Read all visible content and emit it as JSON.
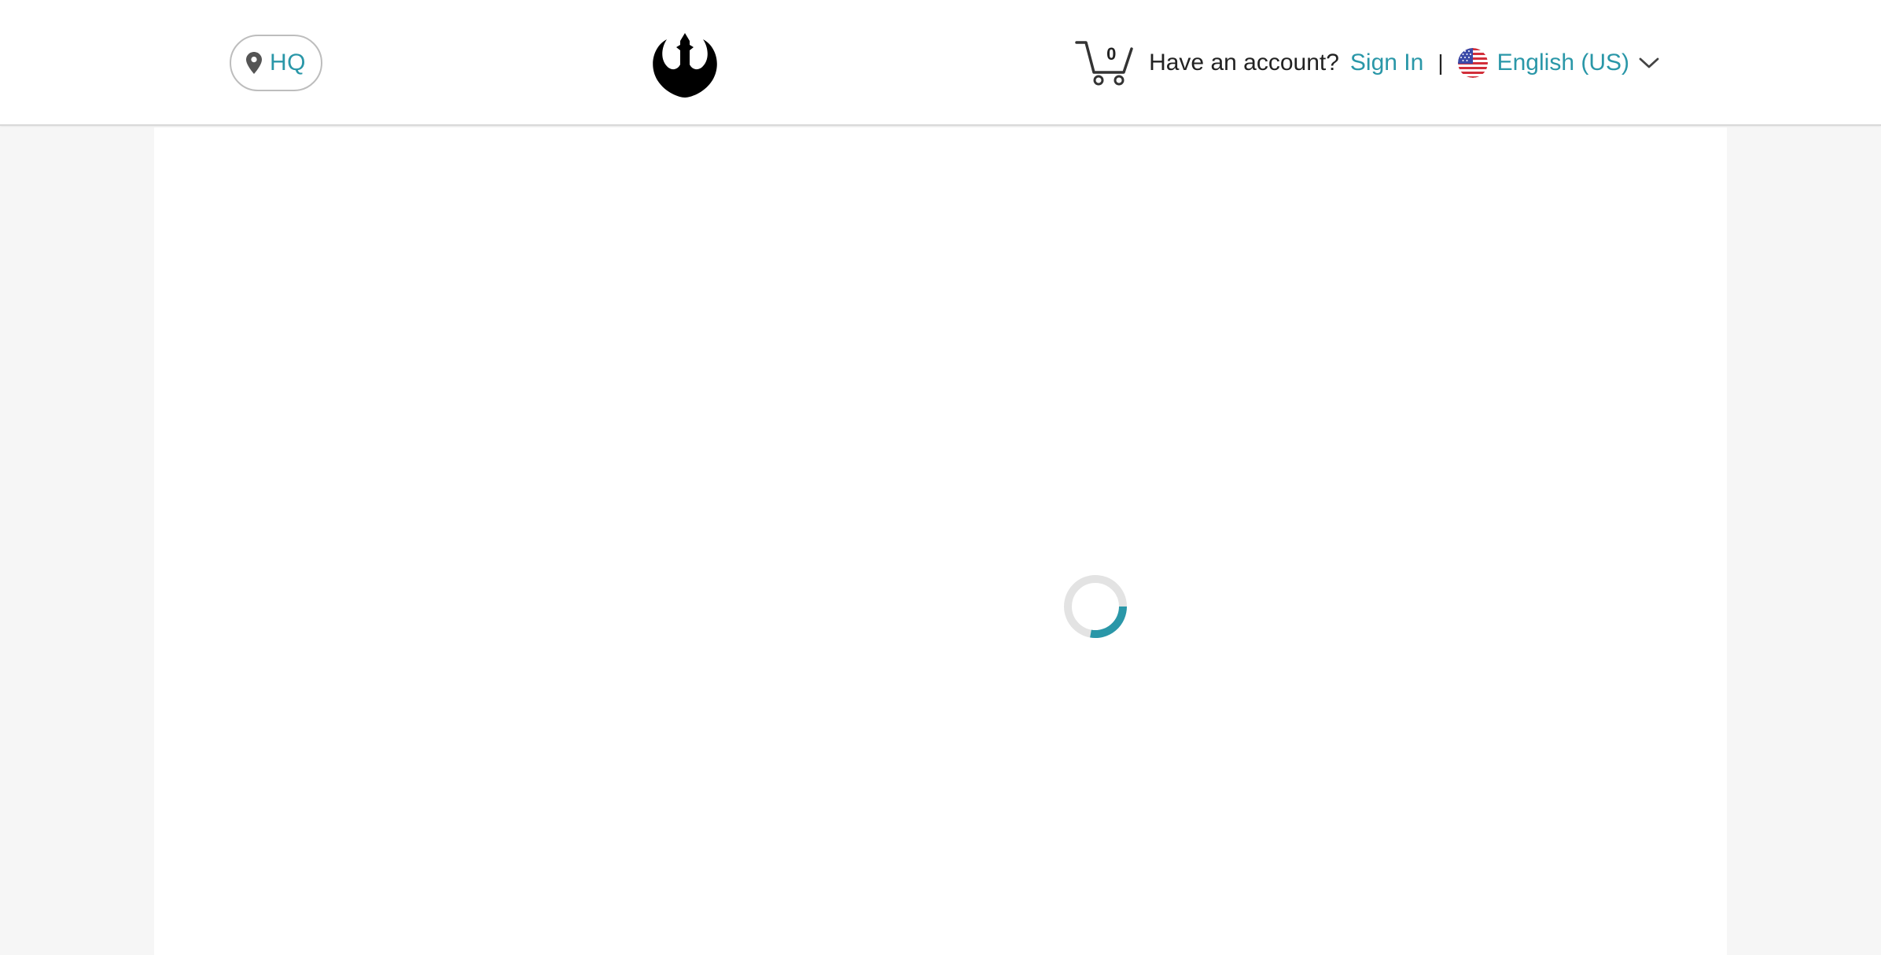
{
  "header": {
    "location": {
      "label": "HQ",
      "icon": "map-pin-icon"
    },
    "logo": {
      "icon": "rebel-alliance-logo"
    },
    "cart": {
      "count": "0",
      "icon": "shopping-cart-icon"
    },
    "account": {
      "prompt": "Have an account?",
      "sign_in_label": "Sign In",
      "divider": "|"
    },
    "language": {
      "selected": "English (US)",
      "flag_icon": "us-flag-icon",
      "chevron_icon": "chevron-down-icon"
    }
  },
  "main": {
    "loading_icon": "loading-spinner-icon"
  },
  "colors": {
    "accent": "#2a97a8",
    "page_background": "#f6f6f6",
    "text": "#222222"
  }
}
